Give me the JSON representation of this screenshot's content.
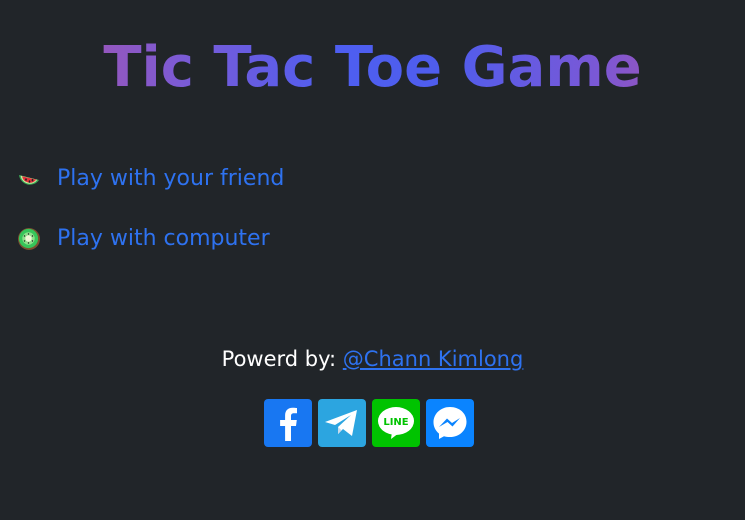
{
  "title": "Tic Tac Toe Game",
  "menu": {
    "items": [
      {
        "label": "Play with your friend",
        "icon": "watermelon-icon"
      },
      {
        "label": "Play with computer",
        "icon": "kiwi-icon"
      }
    ]
  },
  "footer": {
    "prefix": "Powerd by:",
    "author": "@Chann Kimlong"
  },
  "socials": [
    {
      "icon": "facebook-icon",
      "color": "#1877f2"
    },
    {
      "icon": "telegram-icon",
      "color": "#2ca5e0"
    },
    {
      "icon": "line-icon",
      "color": "#00c300"
    },
    {
      "icon": "messenger-icon",
      "color": "#0a84ff"
    }
  ],
  "colors": {
    "background": "#212529",
    "link": "#2e72f0"
  }
}
